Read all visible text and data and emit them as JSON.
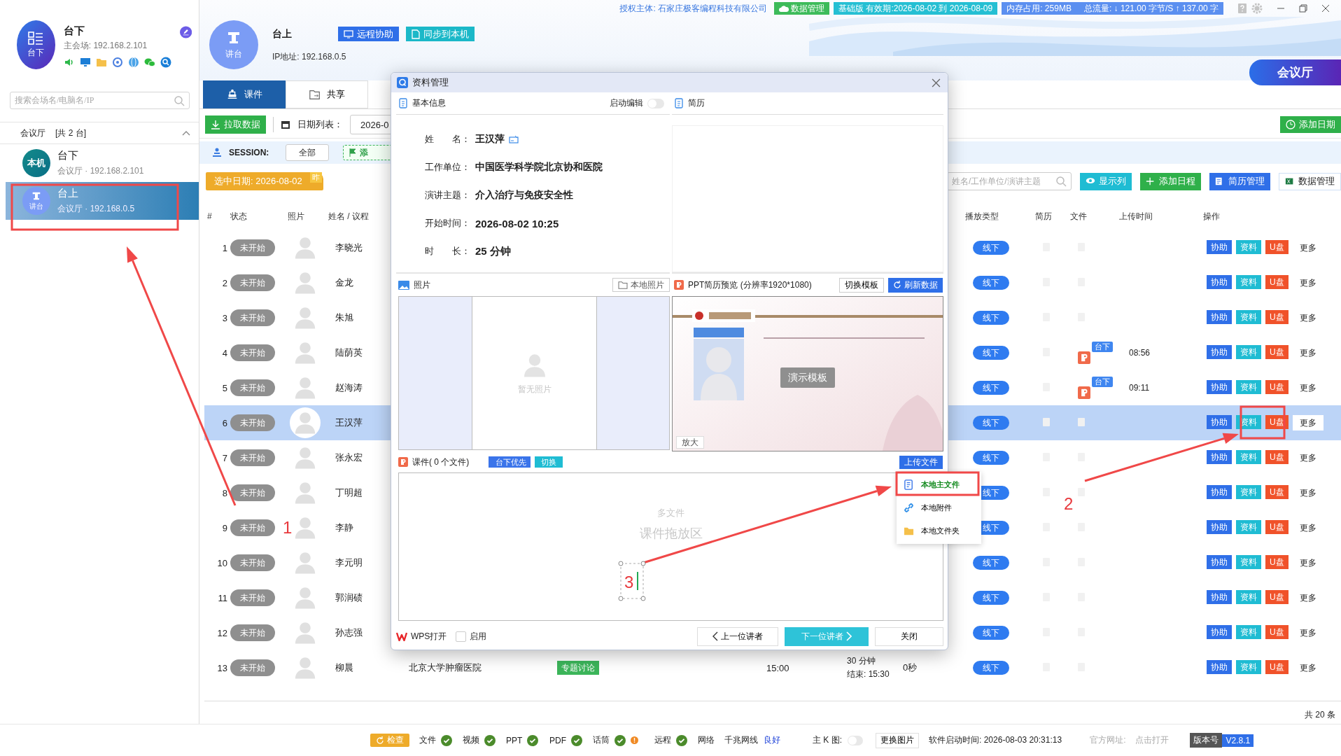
{
  "top_bar": {
    "license": "授权主体: 石家庄极客编程科技有限公司",
    "data_button": "数据管理",
    "edition": "基础版 有效期:2026-08-02 到 2026-08-09",
    "memory": "内存占用:  259MB",
    "traffic": "总流量:  ↓ 121.00 字节/S    ↑ 137.00 字"
  },
  "sidebar": {
    "host": {
      "avatar_label": "台下",
      "name": "台下",
      "subtitle": "主会场: 192.168.2.101"
    },
    "search": {
      "placeholder": "搜索会场名/电脑名/IP"
    },
    "group": {
      "label": "会议厅",
      "count": "[共 2 台]",
      "expanded": true
    },
    "devices": [
      {
        "kind": "label",
        "badge": "本机",
        "name": "台下",
        "detail": "会议厅 · 192.168.2.101",
        "selected": false
      },
      {
        "kind": "podium",
        "badge": "讲台",
        "name": "台上",
        "detail": "会议厅 · 192.168.0.5",
        "selected": true
      }
    ]
  },
  "station": {
    "avatar_label": "讲台",
    "name": "台上",
    "ip": "IP地址: 192.168.0.5",
    "buttons": [
      "远程协助",
      "同步到本机"
    ]
  },
  "hall_button": "会议厅",
  "tabs": [
    {
      "label": "课件",
      "selected": true
    },
    {
      "label": "共享",
      "selected": false
    }
  ],
  "toolbar": {
    "pull_button": "拉取数据",
    "date_label": "日期列表：",
    "date_value": "2026-0",
    "add_date_button": "添加日期"
  },
  "session": {
    "label": "SESSION:",
    "value": "全部",
    "add_button": "添"
  },
  "selected_date": {
    "label": "选中日期:  2026-08-02",
    "badge": "昨"
  },
  "filters": {
    "search_placeholder": "姓名/工作单位/演讲主题",
    "buttons": [
      "显示列",
      "添加日程",
      "简历管理",
      "数据管理"
    ]
  },
  "table": {
    "columns": [
      "#",
      "状态",
      "照片",
      "姓名 / 议程",
      "播放类型",
      "简历",
      "文件",
      "上传时间",
      "操作"
    ],
    "rows": [
      {
        "no": "1",
        "status": "未开始",
        "name": "李晓光",
        "play_type": "线下",
        "actions": [
          "协助",
          "资料",
          "U盘",
          "更多"
        ],
        "selected": false
      },
      {
        "no": "2",
        "status": "未开始",
        "name": "金龙",
        "play_type": "线下",
        "actions": [
          "协助",
          "资料",
          "U盘",
          "更多"
        ],
        "selected": false
      },
      {
        "no": "3",
        "status": "未开始",
        "name": "朱旭",
        "play_type": "线下",
        "actions": [
          "协助",
          "资料",
          "U盘",
          "更多"
        ],
        "selected": false
      },
      {
        "no": "4",
        "status": "未开始",
        "name": "陆荫英",
        "play_type": "线下",
        "file_badge": "台下",
        "upload_time": "08:56",
        "actions": [
          "协助",
          "资料",
          "U盘",
          "更多"
        ],
        "selected": false
      },
      {
        "no": "5",
        "status": "未开始",
        "name": "赵海涛",
        "play_type": "线下",
        "file_badge": "台下",
        "upload_time": "09:11",
        "actions": [
          "协助",
          "资料",
          "U盘",
          "更多"
        ],
        "selected": false
      },
      {
        "no": "6",
        "status": "未开始",
        "name": "王汉萍",
        "play_type": "线下",
        "actions": [
          "协助",
          "资料",
          "U盘",
          "更多"
        ],
        "selected": true
      },
      {
        "no": "7",
        "status": "未开始",
        "name": "张永宏",
        "play_type": "线下",
        "actions": [
          "协助",
          "资料",
          "U盘",
          "更多"
        ],
        "selected": false
      },
      {
        "no": "8",
        "status": "未开始",
        "name": "丁明超",
        "play_type": "线下",
        "actions": [
          "协助",
          "资料",
          "U盘",
          "更多"
        ],
        "selected": false
      },
      {
        "no": "9",
        "status": "未开始",
        "name": "李静",
        "play_type": "线下",
        "actions": [
          "协助",
          "资料",
          "U盘",
          "更多"
        ],
        "selected": false
      },
      {
        "no": "10",
        "status": "未开始",
        "name": "李元明",
        "play_type": "线下",
        "actions": [
          "协助",
          "资料",
          "U盘",
          "更多"
        ],
        "selected": false
      },
      {
        "no": "11",
        "status": "未开始",
        "name": "郭润碛",
        "play_type": "线下",
        "actions": [
          "协助",
          "资料",
          "U盘",
          "更多"
        ],
        "selected": false
      },
      {
        "no": "12",
        "status": "未开始",
        "name": "孙志强",
        "play_type": "线下",
        "actions": [
          "协助",
          "资料",
          "U盘",
          "更多"
        ],
        "selected": false
      },
      {
        "no": "13",
        "status": "未开始",
        "name": "柳晨",
        "unit": "北京大学肿瘤医院",
        "agenda": "专题讨论",
        "start": "15:00",
        "duration": "30 分钟",
        "end": "结束: 15:30",
        "elapsed": "0秒",
        "play_type": "线下",
        "actions": [
          "协助",
          "资料",
          "U盘",
          "更多"
        ],
        "selected": false
      }
    ],
    "total": "共 20 条"
  },
  "dialog": {
    "title": "资料管理",
    "basic_info": {
      "heading": "基本信息",
      "edit_label": "启动编辑",
      "edit_enabled": false,
      "fields": [
        {
          "label": "姓　　名：",
          "value": "王汉萍"
        },
        {
          "label": "工作单位：",
          "value": "中国医学科学院北京协和医院"
        },
        {
          "label": "演讲主题：",
          "value": "介入治疗与免疫安全性"
        },
        {
          "label": "开始时间：",
          "value": "2026-08-02 10:25"
        },
        {
          "label": "时　　长：",
          "value": "25 分钟"
        }
      ]
    },
    "resume": {
      "heading": "简历"
    },
    "photo": {
      "heading": "照片",
      "button": "本地照片",
      "empty": "暂无照片"
    },
    "ppt": {
      "heading": "PPT简历预览 (分辨率1920*1080)",
      "buttons": [
        "切换模板",
        "刷新数据"
      ],
      "overlay": "演示模板",
      "zoom_button": "放大"
    },
    "courseware": {
      "heading": "课件( 0 个文件)",
      "toggle": [
        "台下优先",
        "切换"
      ],
      "upload_button": "上传文件",
      "drop_title": "多文件",
      "drop_hint": "课件拖放区"
    },
    "upload_menu": [
      {
        "label": "本地主文件",
        "selected": true
      },
      {
        "label": "本地附件",
        "selected": false
      },
      {
        "label": "本地文件夹",
        "selected": false
      }
    ],
    "footer": {
      "wps": "WPS打开",
      "enable_label": "启用",
      "enable_checked": false,
      "prev": "上一位讲者",
      "next": "下一位讲者",
      "close": "关闭"
    }
  },
  "status_bar": {
    "check_button": "检查",
    "checks": [
      {
        "label": "文件",
        "ok": true,
        "warning": false
      },
      {
        "label": "视频",
        "ok": true,
        "warning": false
      },
      {
        "label": "PPT",
        "ok": true,
        "warning": false
      },
      {
        "label": "PDF",
        "ok": true,
        "warning": false
      },
      {
        "label": "话筒",
        "ok": true,
        "warning": true
      },
      {
        "label": "远程",
        "ok": true,
        "warning": false
      }
    ],
    "network_label": "网络",
    "network_type": "千兆网线",
    "network_status": "良好",
    "k_label": "主 K 图:",
    "k_on": false,
    "change_image": "更换图片",
    "start_time": "软件启动时间:  2026-08-03 20:31:13",
    "site_label": "官方网址:",
    "site_link": "点击打开",
    "version_label": "版本号",
    "version": "V2.8.1"
  },
  "annotations": [
    {
      "label": "1"
    },
    {
      "label": "2"
    },
    {
      "label": "3"
    }
  ]
}
